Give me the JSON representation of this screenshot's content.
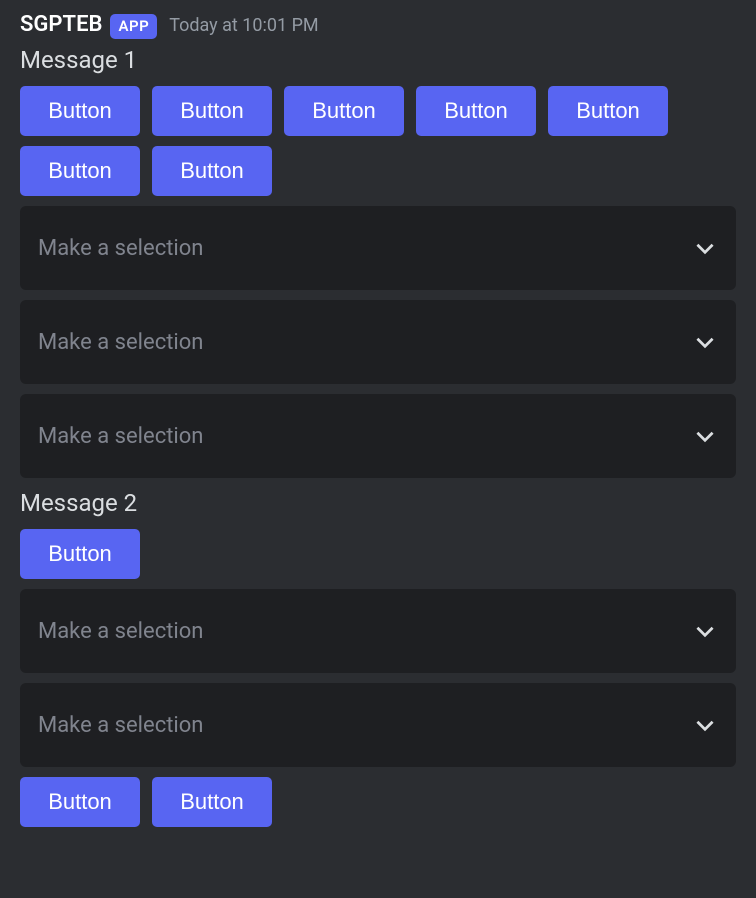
{
  "header": {
    "username": "SGPTEB",
    "badge": "APP",
    "timestamp": "Today at 10:01 PM"
  },
  "messages": [
    {
      "text": "Message 1",
      "rows": [
        {
          "type": "buttons",
          "items": [
            "Button",
            "Button",
            "Button",
            "Button",
            "Button"
          ]
        },
        {
          "type": "buttons",
          "items": [
            "Button",
            "Button"
          ]
        },
        {
          "type": "select",
          "placeholder": "Make a selection"
        },
        {
          "type": "select",
          "placeholder": "Make a selection"
        },
        {
          "type": "select",
          "placeholder": "Make a selection"
        }
      ]
    },
    {
      "text": "Message 2",
      "rows": [
        {
          "type": "buttons",
          "items": [
            "Button"
          ]
        },
        {
          "type": "select",
          "placeholder": "Make a selection"
        },
        {
          "type": "select",
          "placeholder": "Make a selection"
        },
        {
          "type": "buttons",
          "items": [
            "Button",
            "Button"
          ]
        }
      ]
    }
  ]
}
